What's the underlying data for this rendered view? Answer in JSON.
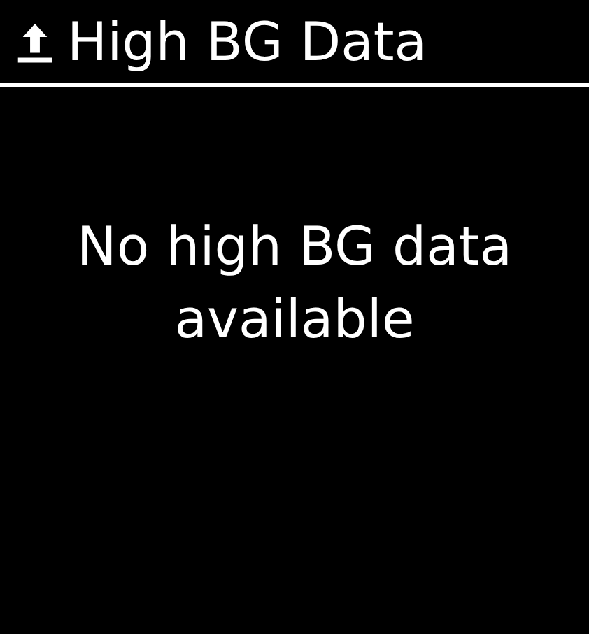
{
  "header": {
    "title": "High BG Data"
  },
  "message": "No high BG data available"
}
